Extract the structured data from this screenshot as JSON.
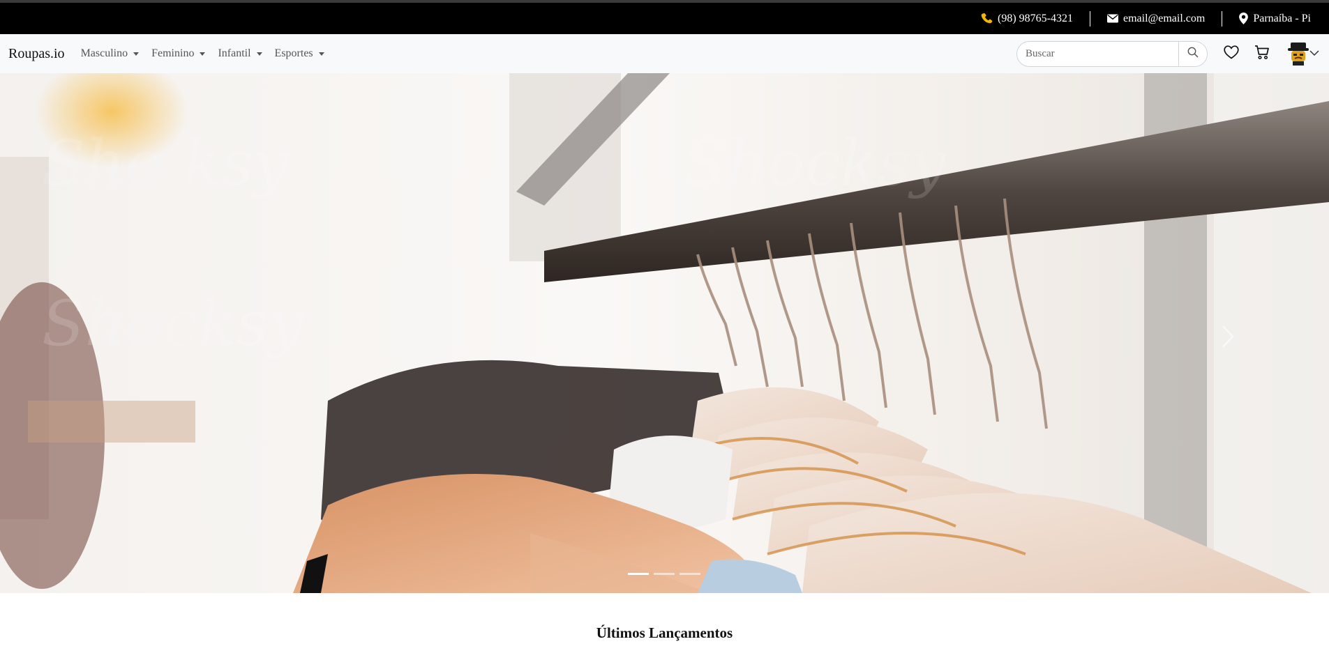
{
  "topbar": {
    "phone": "(98) 98765-4321",
    "email": "email@email.com",
    "location": "Parnaíba - Pi",
    "phone_icon_color": "#f2b705"
  },
  "navbar": {
    "brand": "Roupas.io",
    "menu": [
      {
        "label": "Masculino"
      },
      {
        "label": "Feminino"
      },
      {
        "label": "Infantil"
      },
      {
        "label": "Esportes"
      }
    ],
    "search": {
      "placeholder": "Buscar",
      "value": ""
    },
    "icons": [
      "search-icon",
      "heart-icon",
      "cart-icon",
      "avatar",
      "chevron-down-icon"
    ]
  },
  "hero": {
    "slides": 3,
    "active_slide": 1,
    "controls": [
      "previous",
      "next"
    ]
  },
  "sections": {
    "latest_title": "Últimos Lançamentos"
  },
  "colors": {
    "topbar_bg": "#000000",
    "navbar_bg": "#f8f9fa",
    "text": "#212529"
  }
}
